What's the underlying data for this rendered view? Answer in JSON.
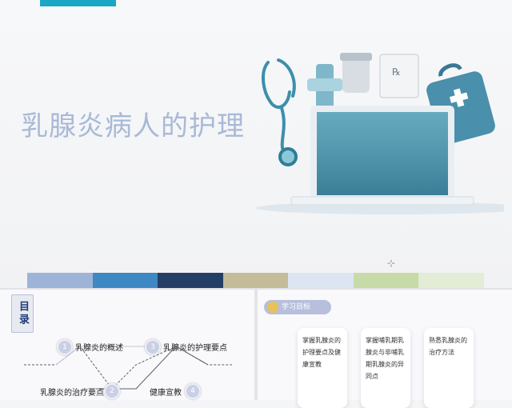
{
  "slide": {
    "title": "乳腺炎病人的护理",
    "color_bar": [
      "#9db4d8",
      "#3e88c4",
      "#243e66",
      "#c4bc98",
      "#dde5f2",
      "#c7dba8",
      "#e3ecd4"
    ],
    "cursor_symbol": "⊹"
  },
  "toc": {
    "label": "目录",
    "items": [
      {
        "num": "1",
        "label": "乳腺炎的概述"
      },
      {
        "num": "2",
        "label": "乳腺炎的治疗要点"
      },
      {
        "num": "3",
        "label": "乳腺炎的护理要点"
      },
      {
        "num": "4",
        "label": "健康宣教"
      }
    ]
  },
  "goals": {
    "pill_label": "学习目标",
    "cards": [
      {
        "text": "掌握乳腺炎的护理要点及健康宣教"
      },
      {
        "text": "掌握哺乳期乳腺炎与非哺乳期乳腺炎的异同点"
      },
      {
        "text": "熟悉乳腺炎的治疗方法"
      }
    ]
  },
  "icons": {
    "illustration": "medical-laptop-illustration",
    "stethoscope": "stethoscope-icon",
    "medical_kit": "medical-kit-icon",
    "goal_bulb": "lightbulb-icon"
  }
}
